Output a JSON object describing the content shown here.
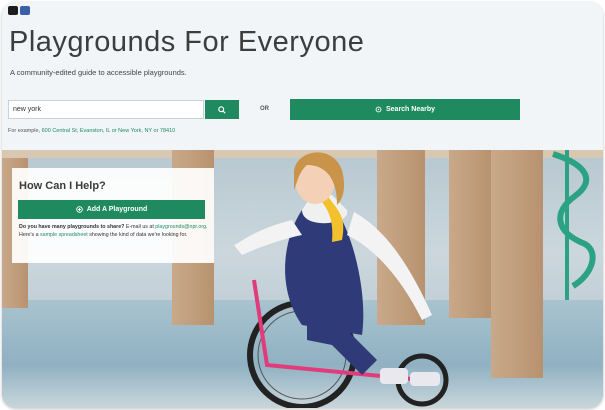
{
  "header": {
    "title": "Playgrounds For Everyone",
    "subtitle": "A community-edited guide to accessible playgrounds.",
    "social_icons": [
      "twitter-icon",
      "facebook-icon"
    ]
  },
  "search": {
    "value": "new york",
    "search_icon": "search-icon",
    "or_label": "OR",
    "nearby_label": "Search Nearby",
    "nearby_icon": "location-icon",
    "example_prefix": "For example, ",
    "example_link": "600 Central St, Evanston, IL or New York, NY or 78410"
  },
  "help": {
    "heading": "How Can I Help?",
    "add_label": "Add A Playground",
    "add_icon": "plus-circle-icon",
    "text_bold": "Do you have many playgrounds to share?",
    "text_mid": " E-mail us at ",
    "email": "playgrounds@npr.org",
    "text_mid2": ". Here's a ",
    "sheet_link": "sample spreadsheet",
    "text_end": " showing the kind of data we're looking for."
  },
  "colors": {
    "accent": "#1f8a60",
    "title": "#3d3d3d",
    "background": "#f1f5f8"
  }
}
